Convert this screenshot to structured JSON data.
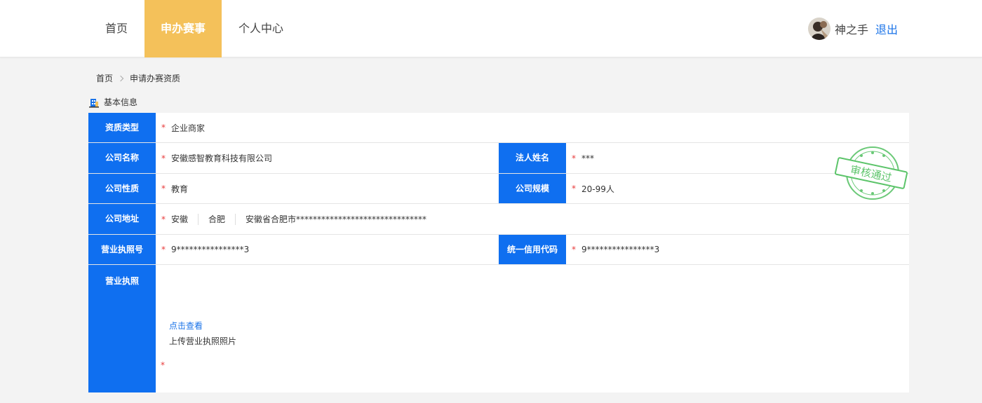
{
  "nav": {
    "items": [
      {
        "label": "首页",
        "active": false
      },
      {
        "label": "申办赛事",
        "active": true
      },
      {
        "label": "个人中心",
        "active": false
      }
    ]
  },
  "user": {
    "name": "神之手",
    "logout": "退出"
  },
  "breadcrumb": {
    "home": "首页",
    "current": "申请办赛资质"
  },
  "section": {
    "title": "基本信息"
  },
  "form": {
    "qualification_type": {
      "label": "资质类型",
      "value": "企业商家"
    },
    "company_name": {
      "label": "公司名称",
      "value": "安徽感智教育科技有限公司"
    },
    "legal_person": {
      "label": "法人姓名",
      "value": "***"
    },
    "company_nature": {
      "label": "公司性质",
      "value": "教育"
    },
    "company_size": {
      "label": "公司规模",
      "value": "20-99人"
    },
    "company_address": {
      "label": "公司地址",
      "province": "安徽",
      "city": "合肥",
      "detail": "安徽省合肥市*******************************"
    },
    "license_number": {
      "label": "营业执照号",
      "value": "9****************3"
    },
    "credit_code": {
      "label": "统一信用代码",
      "value": "9****************3"
    },
    "license_photo": {
      "label": "营业执照",
      "view_link": "点击查看",
      "upload_text": "上传营业执照照片"
    },
    "required_mark": "*"
  },
  "stamp": {
    "text": "审核通过",
    "color": "#5cc46a"
  },
  "colors": {
    "accent": "#f4c15a",
    "label_bg": "#0f6ff0",
    "link": "#1a73e8",
    "required": "#e83b3b"
  }
}
